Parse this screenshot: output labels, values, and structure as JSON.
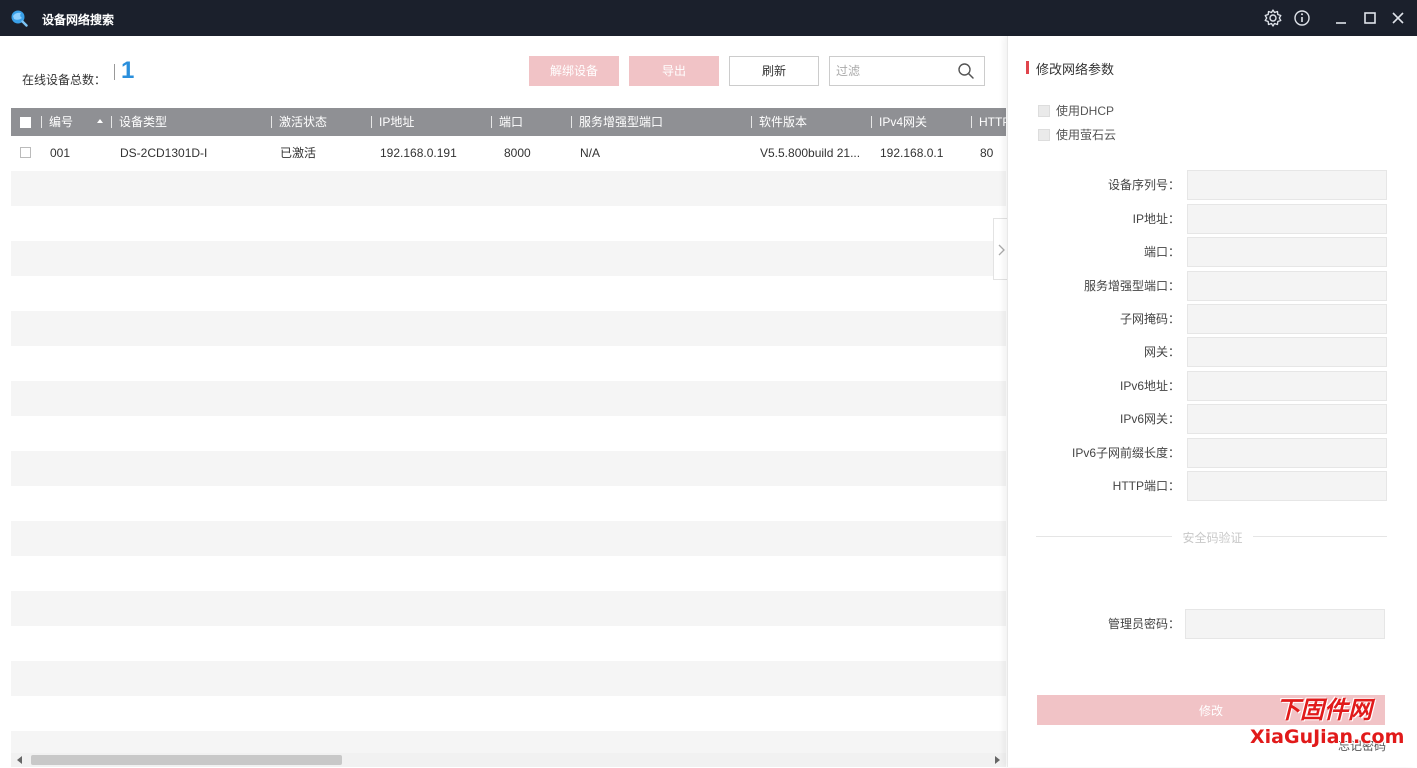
{
  "window": {
    "title": "设备网络搜索",
    "icons": {
      "app": "search-globe-icon",
      "settings": "gear-icon",
      "about": "info-icon",
      "minimize": "minimize-icon",
      "maximize": "maximize-icon",
      "close": "close-icon"
    }
  },
  "toolbar": {
    "online_count_label": "在线设备总数：",
    "online_count": "1",
    "unbind_label": "解绑设备",
    "export_label": "导出",
    "refresh_label": "刷新",
    "filter_placeholder": "过滤",
    "filter_value": ""
  },
  "table": {
    "columns": [
      "编号",
      "设备类型",
      "激活状态",
      "IP地址",
      "端口",
      "服务增强型端口",
      "软件版本",
      "IPv4网关",
      "HTTP端口"
    ],
    "rows": [
      [
        "001",
        "DS-2CD1301D-I",
        "已激活",
        "192.168.0.191",
        "8000",
        "N/A",
        "V5.5.800build 21...",
        "192.168.0.1",
        "80"
      ]
    ]
  },
  "panel": {
    "title": "修改网络参数",
    "use_dhcp": "使用DHCP",
    "use_ezviz": "使用萤石云",
    "fields": {
      "serial": "设备序列号：",
      "ip": "IP地址：",
      "port": "端口：",
      "enhanced_port": "服务增强型端口：",
      "subnet_mask": "子网掩码：",
      "gateway": "网关：",
      "ipv6_address": "IPv6地址：",
      "ipv6_gateway": "IPv6网关：",
      "ipv6_prefix": "IPv6子网前缀长度：",
      "http_port": "HTTP端口："
    },
    "security_divider": "安全码验证",
    "admin_password_label": "管理员密码：",
    "modify_label": "修改",
    "forgot_password": "忘记密码"
  },
  "watermark": {
    "line1": "下固件网",
    "line2": "XiaGuJian.com"
  },
  "colors": {
    "titlebar": "#1b202c",
    "accent_blue": "#2a8fdc",
    "disabled_red": "#f1c3c6",
    "title_marker": "#e0454c",
    "table_header": "#8f9094"
  }
}
